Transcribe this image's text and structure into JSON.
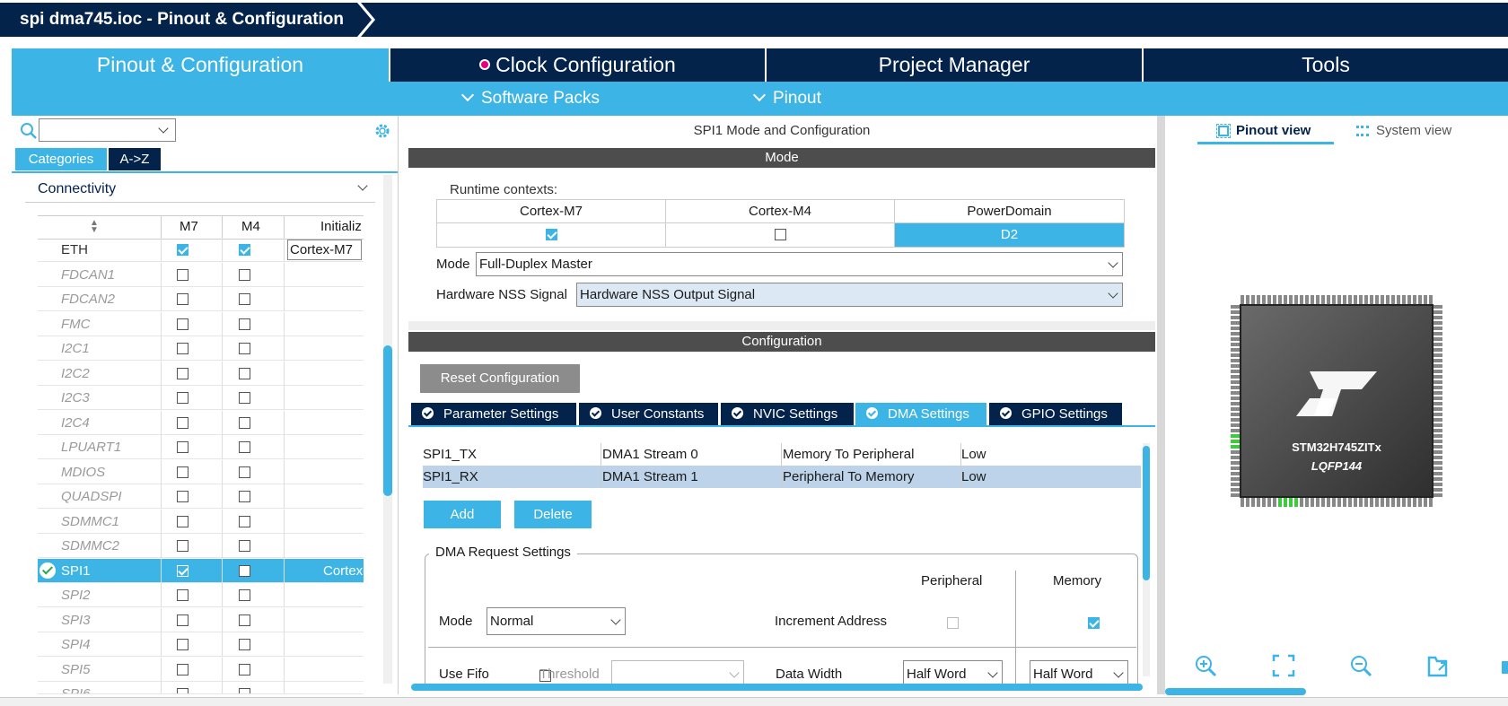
{
  "window": {
    "title": "spi dma745.ioc - Pinout & Configuration"
  },
  "main_tabs": [
    {
      "label": "Pinout & Configuration",
      "active": true
    },
    {
      "label": "Clock Configuration",
      "active": false
    },
    {
      "label": "Project Manager",
      "active": false
    },
    {
      "label": "Tools",
      "active": false
    }
  ],
  "subbar": {
    "software_packs": "Software Packs",
    "pinout": "Pinout"
  },
  "left": {
    "search_value": "",
    "tab_categories": "Categories",
    "tab_az": "A->Z",
    "section": "Connectivity",
    "col_m7": "M7",
    "col_m4": "M4",
    "col_init": "Initializ",
    "rows": [
      {
        "name": "ETH",
        "m7": true,
        "m4": true,
        "ctx": "Cortex-M7"
      },
      {
        "name": "FDCAN1",
        "m7": false,
        "m4": false,
        "ctx": ""
      },
      {
        "name": "FDCAN2",
        "m7": false,
        "m4": false,
        "ctx": ""
      },
      {
        "name": "FMC",
        "m7": false,
        "m4": false,
        "ctx": ""
      },
      {
        "name": "I2C1",
        "m7": false,
        "m4": false,
        "ctx": ""
      },
      {
        "name": "I2C2",
        "m7": false,
        "m4": false,
        "ctx": ""
      },
      {
        "name": "I2C3",
        "m7": false,
        "m4": false,
        "ctx": ""
      },
      {
        "name": "I2C4",
        "m7": false,
        "m4": false,
        "ctx": ""
      },
      {
        "name": "LPUART1",
        "m7": false,
        "m4": false,
        "ctx": ""
      },
      {
        "name": "MDIOS",
        "m7": false,
        "m4": false,
        "ctx": ""
      },
      {
        "name": "QUADSPI",
        "m7": false,
        "m4": false,
        "ctx": ""
      },
      {
        "name": "SDMMC1",
        "m7": false,
        "m4": false,
        "ctx": ""
      },
      {
        "name": "SDMMC2",
        "m7": false,
        "m4": false,
        "ctx": ""
      },
      {
        "name": "SPI1",
        "m7": true,
        "m4": false,
        "ctx": "Cortex-"
      },
      {
        "name": "SPI2",
        "m7": false,
        "m4": false,
        "ctx": ""
      },
      {
        "name": "SPI3",
        "m7": false,
        "m4": false,
        "ctx": ""
      },
      {
        "name": "SPI4",
        "m7": false,
        "m4": false,
        "ctx": ""
      },
      {
        "name": "SPI5",
        "m7": false,
        "m4": false,
        "ctx": ""
      },
      {
        "name": "SPI6",
        "m7": false,
        "m4": false,
        "ctx": ""
      }
    ]
  },
  "mid": {
    "panel_title": "SPI1 Mode and Configuration",
    "mode_header": "Mode",
    "runtime_label": "Runtime contexts:",
    "ctx_cols": [
      "Cortex-M7",
      "Cortex-M4",
      "PowerDomain"
    ],
    "ctx_m7": true,
    "ctx_m4": false,
    "power_domain": "D2",
    "mode_label": "Mode",
    "mode_value": "Full-Duplex Master",
    "nss_label": "Hardware NSS Signal",
    "nss_value": "Hardware NSS Output Signal",
    "config_header": "Configuration",
    "reset_button": "Reset Configuration",
    "tabs": [
      "Parameter Settings",
      "User Constants",
      "NVIC Settings",
      "DMA Settings",
      "GPIO Settings"
    ],
    "active_tab": "DMA Settings",
    "dma_rows": [
      {
        "request": "SPI1_TX",
        "stream": "DMA1 Stream 0",
        "direction": "Memory To Peripheral",
        "priority": "Low"
      },
      {
        "request": "SPI1_RX",
        "stream": "DMA1 Stream 1",
        "direction": "Peripheral To Memory",
        "priority": "Low"
      }
    ],
    "add_button": "Add",
    "delete_button": "Delete",
    "req_group": "DMA Request Settings",
    "peripheral_label": "Peripheral",
    "memory_label": "Memory",
    "req_mode_label": "Mode",
    "req_mode_value": "Normal",
    "increment_label": "Increment Address",
    "inc_peripheral": false,
    "inc_memory": true,
    "use_fifo_label": "Use Fifo",
    "threshold_label": "Threshold",
    "threshold_value": "",
    "data_width_label": "Data Width",
    "data_width_periph": "Half Word",
    "data_width_mem": "Half Word"
  },
  "right": {
    "pinout_view": "Pinout view",
    "system_view": "System view",
    "chip_name": "STM32H745ZITx",
    "package": "LQFP144"
  },
  "colors": {
    "accent": "#3cb4e5",
    "navy": "#03234b"
  }
}
